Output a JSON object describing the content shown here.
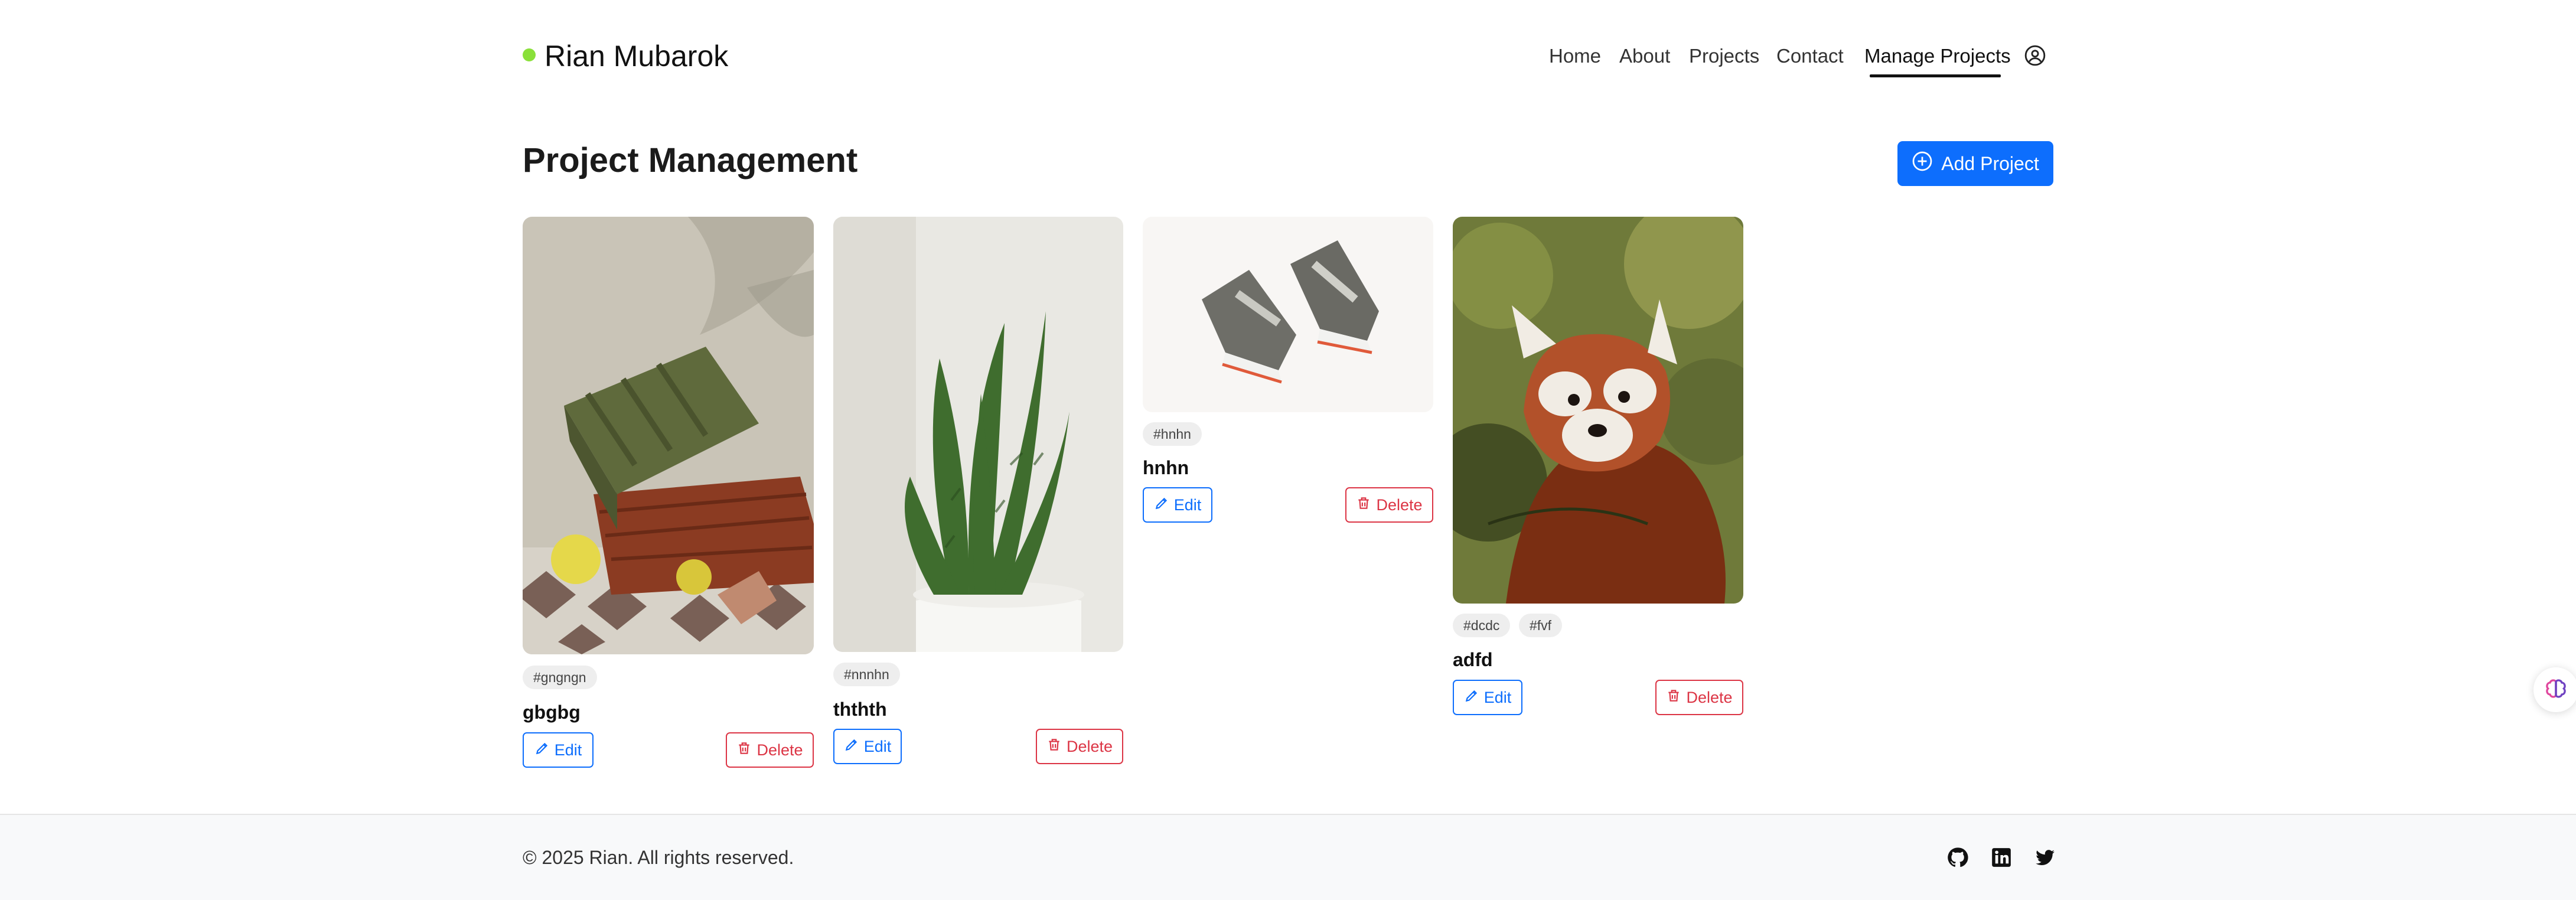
{
  "brand": {
    "name": "Rian Mubarok",
    "dot_color": "#8ae03a"
  },
  "nav": {
    "items": [
      {
        "label": "Home"
      },
      {
        "label": "About"
      },
      {
        "label": "Projects"
      },
      {
        "label": "Contact"
      },
      {
        "label": "Manage Projects",
        "active": true
      }
    ],
    "user_icon": "user-circle-icon"
  },
  "main": {
    "title": "Project Management",
    "add_button": {
      "label": "Add Project",
      "icon": "plus-circle-icon",
      "color": "#0d6efd"
    }
  },
  "projects": [
    {
      "image": "green-bag-still-life",
      "tags": [
        "#gngngn"
      ],
      "title": "gbgbg",
      "edit_label": "Edit",
      "delete_label": "Delete"
    },
    {
      "image": "snake-plant-pot",
      "tags": [
        "#nnnhn"
      ],
      "title": "ththth",
      "edit_label": "Edit",
      "delete_label": "Delete"
    },
    {
      "image": "sneakers-pair",
      "tags": [
        "#hnhn"
      ],
      "title": "hnhn",
      "edit_label": "Edit",
      "delete_label": "Delete"
    },
    {
      "image": "red-panda",
      "tags": [
        "#dcdc",
        "#fvf"
      ],
      "title": "adfd",
      "edit_label": "Edit",
      "delete_label": "Delete"
    }
  ],
  "footer": {
    "copyright": "© 2025 Rian. All rights reserved.",
    "social": [
      "github-icon",
      "linkedin-icon",
      "twitter-icon"
    ]
  },
  "floating": {
    "icon": "brain-icon"
  },
  "colors": {
    "primary": "#0d6efd",
    "danger": "#dc3545",
    "tag_bg": "#eeeeee",
    "footer_bg": "#f8f9fa"
  }
}
